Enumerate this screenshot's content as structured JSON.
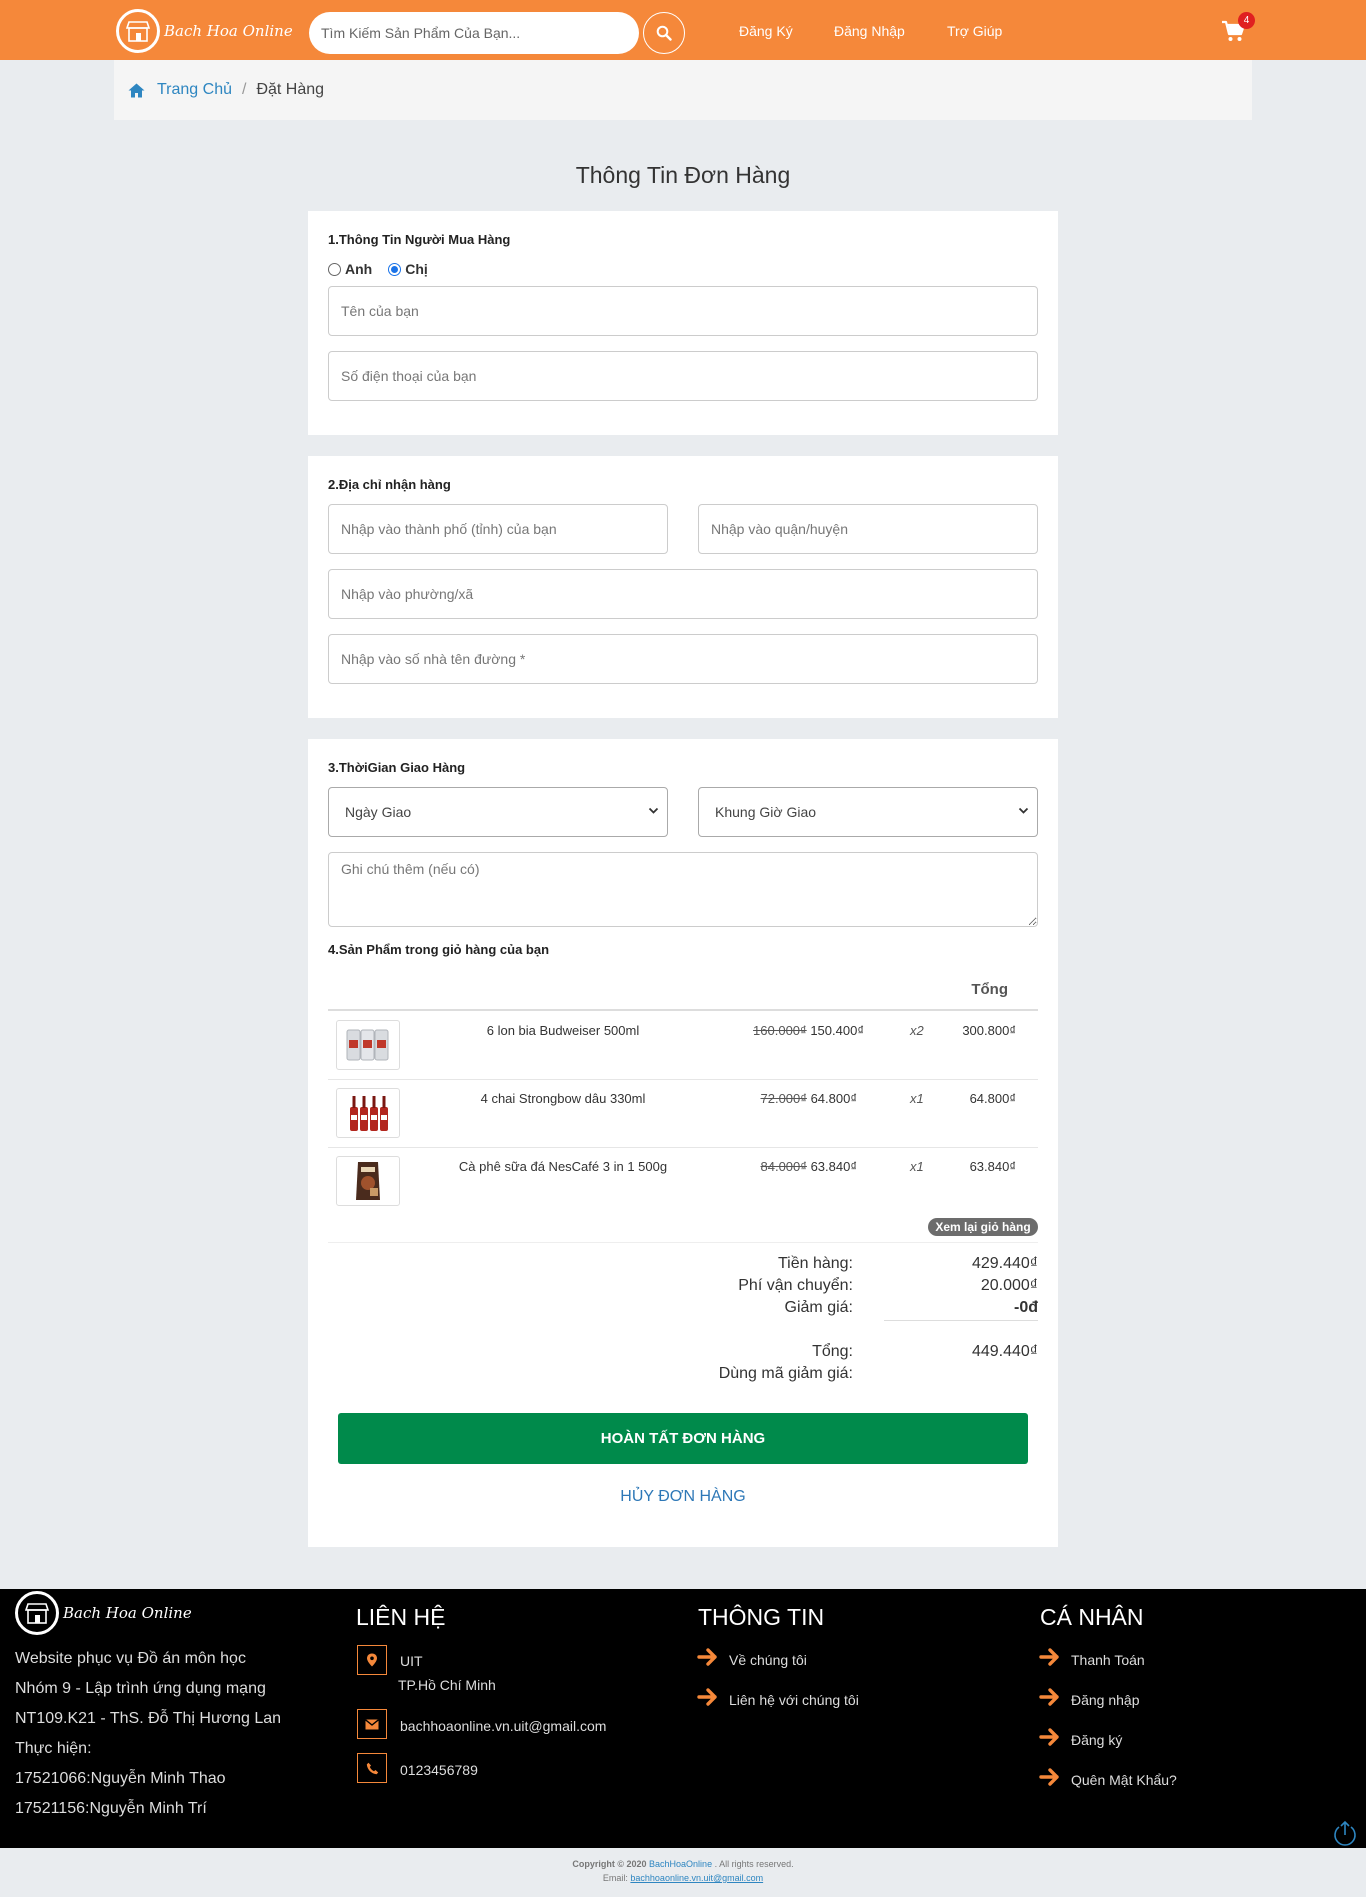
{
  "header": {
    "logo_text": "Bach Hoa Online",
    "search_placeholder": "Tìm Kiếm Sản Phẩm Của Bạn...",
    "nav": [
      "Đăng Ký",
      "Đăng Nhập",
      "Trợ Giúp"
    ],
    "cart_count": "4",
    "accent_color": "#f5883a"
  },
  "breadcrumb": {
    "home": "Trang Chủ",
    "current": "Đặt Hàng"
  },
  "page_title": "Thông Tin Đơn Hàng",
  "buyer": {
    "title": "1.Thông Tin Người Mua Hàng",
    "gender_options": [
      "Anh",
      "Chị"
    ],
    "gender_selected": "Chị",
    "name_placeholder": "Tên của bạn",
    "phone_placeholder": "Số điện thoại của bạn"
  },
  "address": {
    "title": "2.Địa chỉ nhận hàng",
    "city_placeholder": "Nhập vào thành phố (tỉnh) của bạn",
    "district_placeholder": "Nhập vào quận/huyện",
    "ward_placeholder": "Nhập vào phường/xã",
    "street_placeholder": "Nhập vào số nhà tên đường *"
  },
  "delivery": {
    "title": "3.ThờiGian Giao Hàng",
    "date_select": "Ngày Giao",
    "time_select": "Khung Giờ Giao",
    "note_placeholder": "Ghi chú thêm (nếu có)"
  },
  "cart": {
    "title": "4.Sản Phẩm trong giỏ hàng của bạn",
    "total_header": "Tổng",
    "items": [
      {
        "name": "6 lon bia Budweiser 500ml",
        "old_price": "160.000₫",
        "price": "150.400₫",
        "qty": "x2",
        "total": "300.800₫",
        "icon": "beer-can-pack-icon"
      },
      {
        "name": "4 chai Strongbow dâu 330ml",
        "old_price": "72.000₫",
        "price": "64.800₫",
        "qty": "x1",
        "total": "64.800₫",
        "icon": "cider-bottles-icon"
      },
      {
        "name": "Cà phê sữa đá NesCafé 3 in 1 500g",
        "old_price": "84.000₫",
        "price": "63.840₫",
        "qty": "x1",
        "total": "63.840₫",
        "icon": "coffee-pack-icon"
      }
    ],
    "review_label": "Xem lại giỏ hàng"
  },
  "summary": {
    "subtotal_label": "Tiền hàng:",
    "subtotal": "429.440₫",
    "shipping_label": "Phí vận chuyển:",
    "shipping": "20.000₫",
    "discount_label": "Giảm giá:",
    "discount": "-0đ",
    "total_label": "Tổng:",
    "total": "449.440₫",
    "coupon_label": "Dùng mã giảm giá:"
  },
  "actions": {
    "complete": "HOÀN TẤT ĐƠN HÀNG",
    "cancel": "HỦY ĐƠN HÀNG"
  },
  "footer": {
    "logo_text": "Bach Hoa Online",
    "about": [
      "Website phục vụ Đồ án môn học",
      "Nhóm 9 - Lập trình ứng dụng mạng",
      "NT109.K21 - ThS. Đỗ Thị Hương Lan",
      "Thực hiện:",
      "17521066:Nguyễn Minh Thao",
      "17521156:Nguyễn Minh Trí"
    ],
    "contact_title": "LIÊN HỆ",
    "contact_address_1": "UIT",
    "contact_address_2": "TP.Hồ Chí Minh",
    "contact_email": "bachhoaonline.vn.uit@gmail.com",
    "contact_phone": "0123456789",
    "info_title": "THÔNG TIN",
    "info_links": [
      "Về chúng tôi",
      "Liên hệ với chúng tôi"
    ],
    "personal_title": "CÁ NHÂN",
    "personal_links": [
      "Thanh Toán",
      "Đăng nhập",
      "Đăng ký",
      "Quên Mật Khẩu?"
    ]
  },
  "copyright": {
    "prefix": "Copyright © 2020",
    "brand": "BachHoaOnline",
    "suffix": ". All rights reserved.",
    "email_label": "Email:",
    "email": "bachhoaonline.vn.uit@gmail.com"
  }
}
